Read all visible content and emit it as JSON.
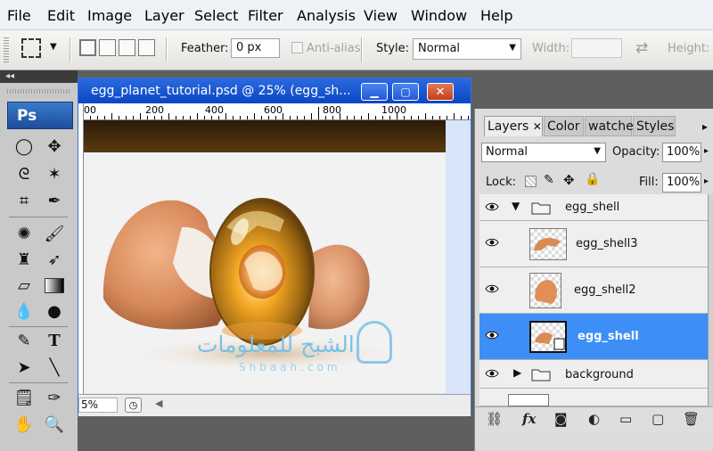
{
  "menu": [
    "File",
    "Edit",
    "Image",
    "Layer",
    "Select",
    "Filter",
    "Analysis",
    "View",
    "Window",
    "Help"
  ],
  "options": {
    "feather_label": "Feather:",
    "feather_value": "0 px",
    "antialias_label": "Anti-alias",
    "style_label": "Style:",
    "style_value": "Normal",
    "width_label": "Width:",
    "height_label": "Height:"
  },
  "tools": {
    "logo": "Ps",
    "collapse": "◂◂"
  },
  "document": {
    "title": "egg_planet_tutorial.psd @ 25% (egg_sh...",
    "zoom": "5%",
    "ruler_labels": [
      "00",
      "200",
      "400",
      "600",
      "800",
      "1000"
    ]
  },
  "layers_panel": {
    "tabs": [
      "Layers",
      "Color",
      "watches",
      "Styles"
    ],
    "blend_mode": "Normal",
    "opacity_label": "Opacity:",
    "opacity_value": "100%",
    "lock_label": "Lock:",
    "fill_label": "Fill:",
    "fill_value": "100%",
    "layers": [
      {
        "name": "egg_shell",
        "kind": "group",
        "expanded": true
      },
      {
        "name": "egg_shell3",
        "kind": "layer"
      },
      {
        "name": "egg_shell2",
        "kind": "layer"
      },
      {
        "name": "egg_shell",
        "kind": "smart-object",
        "selected": true
      },
      {
        "name": "background",
        "kind": "group",
        "expanded": false
      }
    ]
  },
  "watermark": {
    "arabic": "الشبح للمعلومات",
    "latin": "Shbaah.com"
  },
  "colors": {
    "title_bar": "#1a56d2",
    "selected_layer": "#3d8ff7",
    "ps_logo": "#2a64b8"
  }
}
